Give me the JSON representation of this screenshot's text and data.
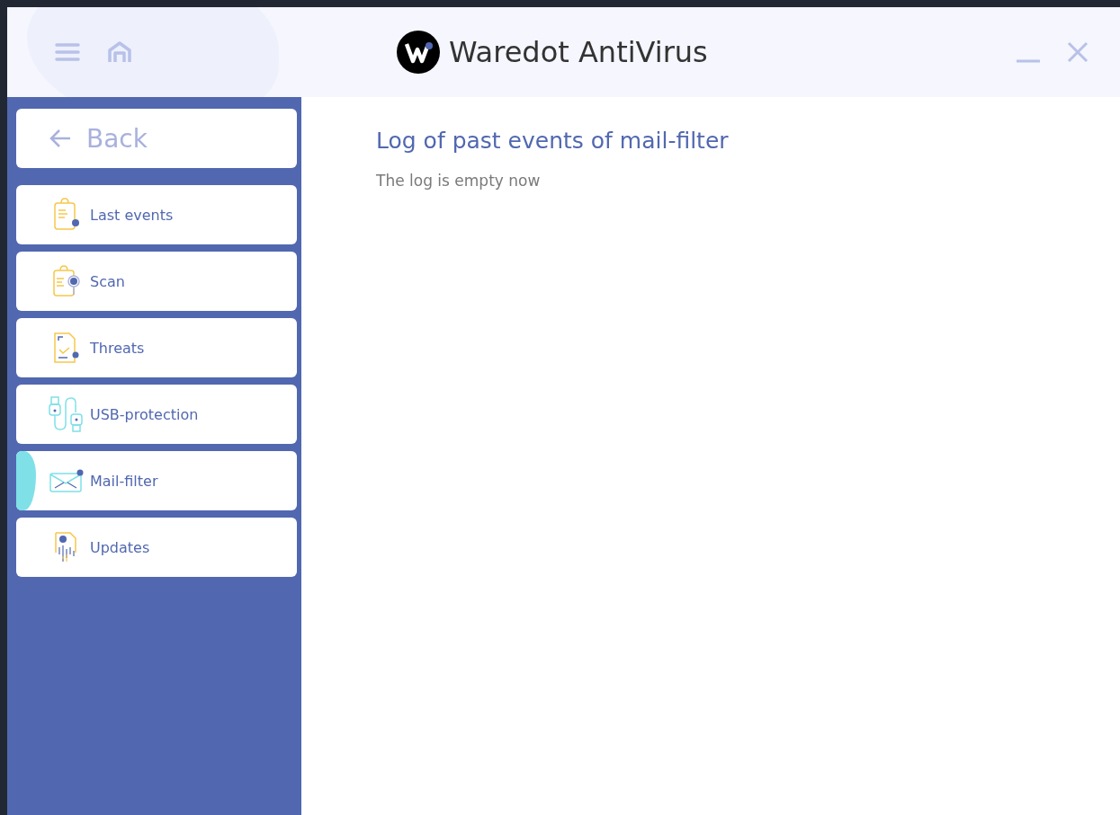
{
  "window": {
    "title": "Waredot AntiVirus"
  },
  "sidebar": {
    "back": {
      "label": "Back"
    },
    "items": [
      {
        "kind": "events",
        "label": "Last events",
        "selected": false
      },
      {
        "kind": "scan",
        "label": "Scan",
        "selected": false
      },
      {
        "kind": "threats",
        "label": "Threats",
        "selected": false
      },
      {
        "kind": "usb",
        "label": "USB-protection",
        "selected": false
      },
      {
        "kind": "mail",
        "label": "Mail-filter",
        "selected": true
      },
      {
        "kind": "updates",
        "label": "Updates",
        "selected": false
      }
    ]
  },
  "content": {
    "heading": "Log of past events of mail-filter",
    "message": "The log is empty now"
  }
}
